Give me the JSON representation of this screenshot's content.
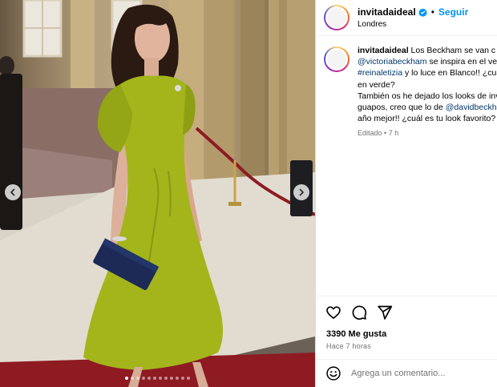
{
  "post": {
    "username": "invitadaideal",
    "follow_label": "Seguir",
    "separator": "•",
    "location": "Londres",
    "caption": {
      "user": "invitadaideal",
      "lines": [
        "Los Beckham se van c",
        "se inspira en el ves",
        "y lo luce en Blanco!! ¿cuá",
        "en verde?",
        "También os he dejado los looks de inv",
        "guapos, creo que lo de",
        "año mejor!! ¿cuál es tu look favorito?"
      ],
      "mention_victoria": "@victoriabeckham",
      "hashtag": "#reinaletizia",
      "mention_david": "@davidbeckha",
      "edited_label": "Editado",
      "edited_sep": "•",
      "edited_time": "7 h"
    },
    "likes": "3390 Me gusta",
    "timestamp": "Hace 7 horas",
    "comment_placeholder": "Agrega un comentario..."
  },
  "carousel": {
    "slide_count": 12,
    "active_slide": 1,
    "prev_icon": "chevron-left-icon",
    "next_icon": "chevron-right-icon"
  },
  "icons": {
    "verified": "verified-badge-icon",
    "like": "heart-icon",
    "comment": "comment-bubble-icon",
    "share": "paper-plane-icon",
    "emoji": "emoji-icon"
  },
  "colors": {
    "follow_blue": "#0095f6",
    "mention_blue": "#00376b",
    "verified_blue": "#0095f6",
    "dress_green": "#a3b51b",
    "carpet_red": "#8e1b22",
    "secondary_text": "#737373"
  }
}
